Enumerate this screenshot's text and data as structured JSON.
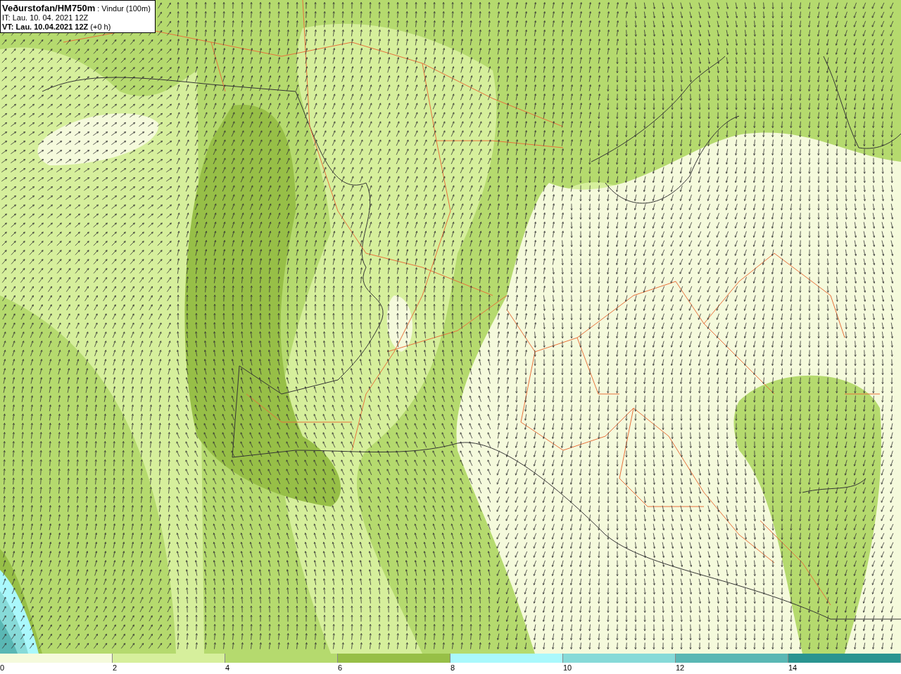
{
  "header": {
    "title": "Veðurstofan/HM750m",
    "subtitle": ": Vindur (100m)",
    "issue_time": "IT: Lau. 10. 04. 2021 12Z",
    "valid_time": "**VT: Lau. 10.04.2021 12Z** (+0 h)"
  },
  "legend": {
    "bins": [
      {
        "label": "0",
        "color": "#f5fadc"
      },
      {
        "label": "2",
        "color": "#d6ef9c"
      },
      {
        "label": "4",
        "color": "#b5da6e"
      },
      {
        "label": "6",
        "color": "#97bf47"
      },
      {
        "label": "8",
        "color": "#aaf8fc"
      },
      {
        "label": "10",
        "color": "#87dad8"
      },
      {
        "label": "12",
        "color": "#5ab7b4"
      },
      {
        "label": "14",
        "color": "#2a9490"
      }
    ]
  }
}
